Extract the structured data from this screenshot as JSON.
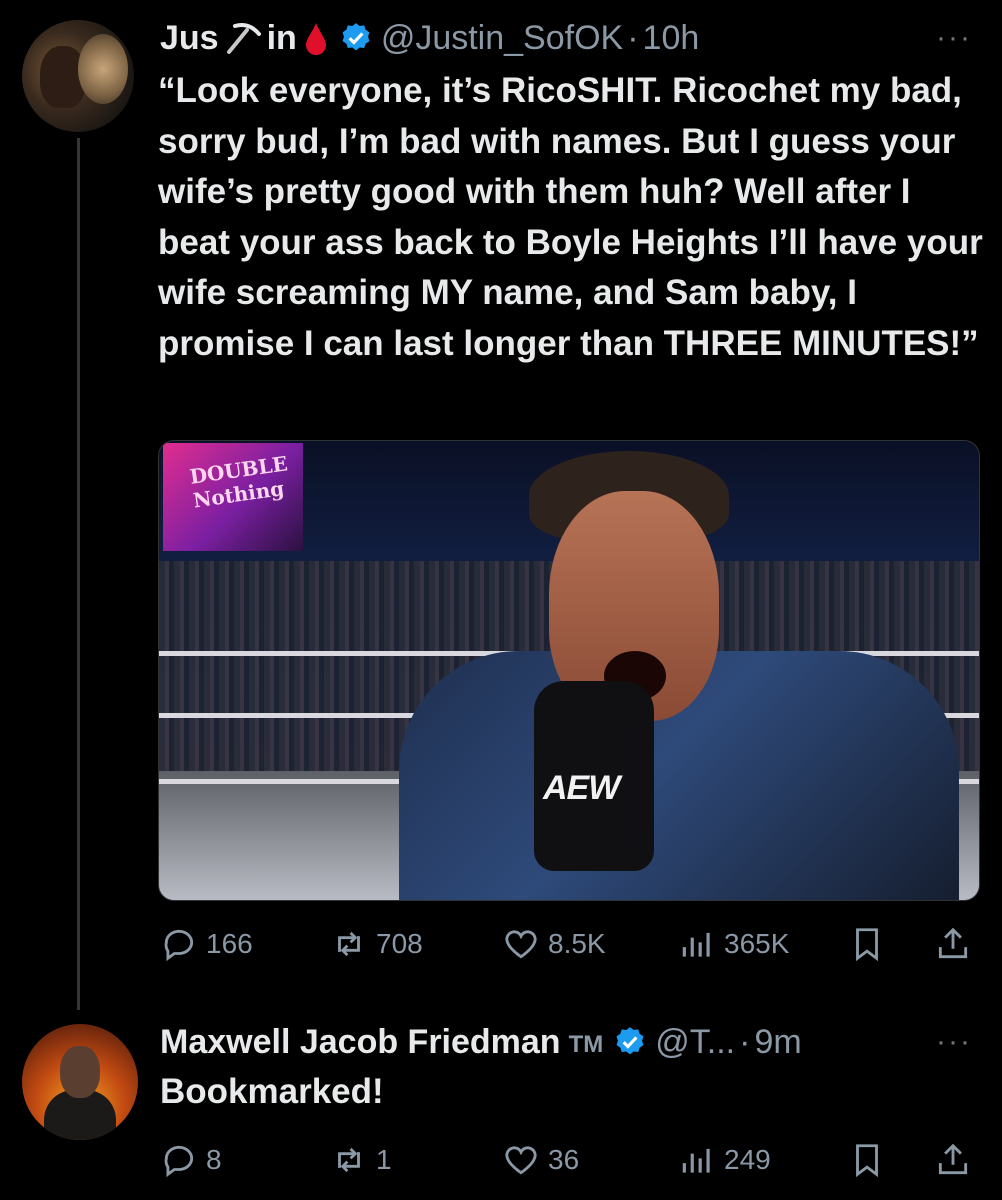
{
  "tweet": {
    "author_name": "Jus",
    "author_name_mid": "in",
    "handle": "@Justin_SofOK",
    "time": "10h",
    "text": "“Look everyone, it’s RicoSHIT. Ricochet my bad, sorry bud, I’m bad with names. But I guess your wife’s pretty good with them huh? Well after I beat your ass back to Boyle Heights I’ll have your wife screaming MY name, and Sam baby, I promise I can last longer than THREE MINUTES!”",
    "media": {
      "sign_text": "DOUBLE Nothing",
      "mic_logo": "AEW"
    },
    "stats": {
      "replies": "166",
      "reposts": "708",
      "likes": "8.5K",
      "views": "365K"
    }
  },
  "reply": {
    "author_name": "Maxwell Jacob Friedman",
    "trademark": "TM",
    "handle": "@T...",
    "time": "9m",
    "text": "Bookmarked!",
    "stats": {
      "replies": "8",
      "reposts": "1",
      "likes": "36",
      "views": "249"
    }
  },
  "separator": "·",
  "more": "···",
  "colors": {
    "background": "#000000",
    "text": "#e7e9ea",
    "muted": "#8b98a5",
    "verified": "#1d9bf0"
  }
}
